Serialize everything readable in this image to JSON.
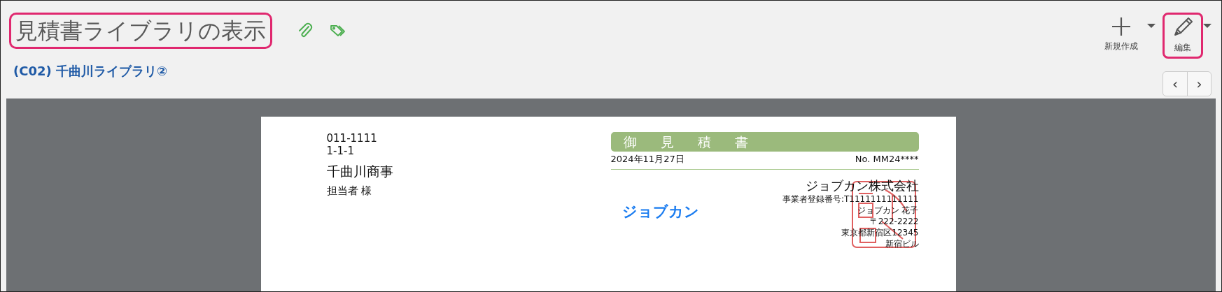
{
  "header": {
    "title": "見積書ライブラリの表示",
    "title_highlighted": true,
    "breadcrumb": "(C02) 千曲川ライブラリ②"
  },
  "toolbar": [
    {
      "kind": "new",
      "label": "新規作成",
      "highlighted": false
    },
    {
      "kind": "edit",
      "label": "編集",
      "highlighted": true
    }
  ],
  "pager": [
    "‹",
    "›"
  ],
  "document": {
    "recipient_lines": [
      "011-1111",
      "1-1-1"
    ],
    "recipient_name": "千曲川商事",
    "recipient_person": "担当者 様",
    "heading": "御 見 積 書",
    "date": "2024年11月27日",
    "number": "No. MM24****",
    "logo": "ジョブカン",
    "company": "ジョブカン株式会社",
    "company_lines": [
      "事業者登録番号:T1111111111111",
      "ジョブカン 花子",
      "〒222-2222",
      "東京都新宿区12345",
      "新宿ビル"
    ]
  }
}
